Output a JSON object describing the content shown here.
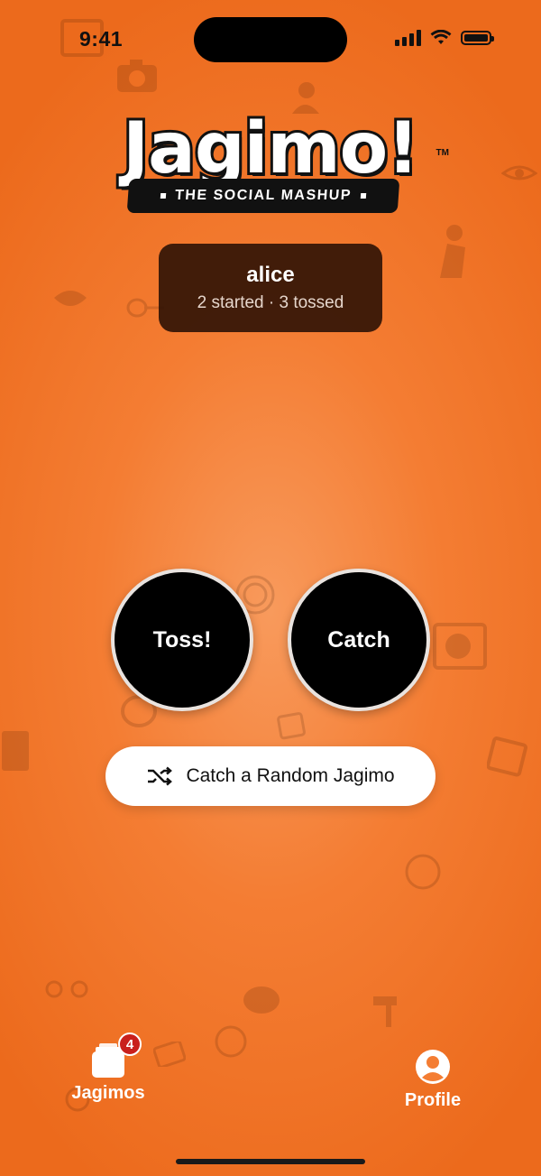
{
  "status_bar": {
    "time": "9:41"
  },
  "logo": {
    "word": "Jagimo!",
    "tagline": "THE SOCIAL MASHUP",
    "trademark": "TM"
  },
  "user_card": {
    "name": "alice",
    "stats": "2 started · 3 tossed"
  },
  "actions": {
    "toss_label": "Toss!",
    "catch_label": "Catch",
    "random_label": "Catch a Random Jagimo"
  },
  "tab_bar": {
    "jagimos_label": "Jagimos",
    "jagimos_badge": "4",
    "profile_label": "Profile"
  },
  "colors": {
    "background": "#f47d33",
    "card": "#2d1206",
    "badge": "#c9201d"
  },
  "icons": [
    "shuffle-icon",
    "stack-icon",
    "profile-icon",
    "signal-icon",
    "wifi-icon",
    "battery-icon"
  ]
}
